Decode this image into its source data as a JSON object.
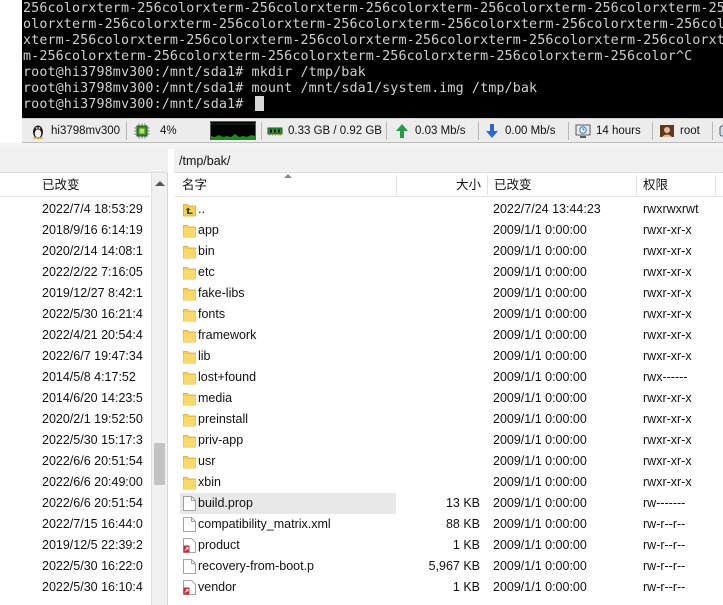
{
  "terminal": {
    "lines": [
      "256colorxterm-256colorxterm-256colorxterm-256colorxterm-256colorxterm-256colorxterm-256color",
      "olorxterm-256colorxterm-256colorxterm-256colorxterm-256colorxterm-256colorxterm-256colorxterm-256col",
      "xterm-256colorxterm-256colorxterm-256colorxterm-256colorxterm-256colorxterm-256colorxterm-256colorx",
      "m-256colorxterm-256colorxterm-256colorxterm-256colorxterm-256colorxterm-256color^C",
      "root@hi3798mv300:/mnt/sda1# mkdir /tmp/bak",
      "root@hi3798mv300:/mnt/sda1# mount /mnt/sda1/system.img /tmp/bak",
      "root@hi3798mv300:/mnt/sda1# "
    ]
  },
  "status_bar": {
    "hostname": "hi3798mv300",
    "cpu": "4%",
    "memory": "0.33 GB / 0.92 GB",
    "upload": "0.03 Mb/s",
    "download": "0.00 Mb/s",
    "uptime": "14 hours",
    "user": "root",
    "icons": [
      "linux-penguin-icon",
      "cpu-chip-icon",
      "cpu-graph",
      "memory-icon",
      "upload-arrow-icon",
      "download-arrow-icon",
      "uptime-monitor-icon",
      "user-icon",
      "disk-icon"
    ]
  },
  "left_pane": {
    "column_modified": "已改变",
    "dates": [
      "2022/7/4  18:53:29",
      "2018/9/16  6:14:19",
      "2020/2/14  14:08:1",
      "2022/2/22  7:16:05",
      "2019/12/27  8:42:1",
      "2022/5/30  16:21:4",
      "2022/4/21  20:54:4",
      "2022/6/7  19:47:34",
      "2014/5/8  4:17:52",
      "2014/6/20  14:23:5",
      "2020/2/1  19:52:50",
      "2022/5/30  15:17:3",
      "2022/6/6  20:51:54",
      "2022/6/6  20:49:00",
      "2022/6/6  20:51:54",
      "2022/7/15  16:44:0",
      "2019/12/5  22:39:2",
      "2022/5/30  16:22:0",
      "2022/5/30  16:10:4"
    ]
  },
  "right_pane": {
    "path": "/tmp/bak/",
    "columns": {
      "name": "名字",
      "size": "大小",
      "modified": "已改变",
      "permissions": "权限"
    },
    "rows": [
      {
        "name": "..",
        "size": "",
        "date": "2022/7/24 13:44:23",
        "perm": "rwxrwxrwt",
        "icon": "parent-folder-icon"
      },
      {
        "name": "app",
        "size": "",
        "date": "2009/1/1 0:00:00",
        "perm": "rwxr-xr-x",
        "icon": "folder-icon"
      },
      {
        "name": "bin",
        "size": "",
        "date": "2009/1/1 0:00:00",
        "perm": "rwxr-xr-x",
        "icon": "folder-icon"
      },
      {
        "name": "etc",
        "size": "",
        "date": "2009/1/1 0:00:00",
        "perm": "rwxr-xr-x",
        "icon": "folder-icon"
      },
      {
        "name": "fake-libs",
        "size": "",
        "date": "2009/1/1 0:00:00",
        "perm": "rwxr-xr-x",
        "icon": "folder-icon"
      },
      {
        "name": "fonts",
        "size": "",
        "date": "2009/1/1 0:00:00",
        "perm": "rwxr-xr-x",
        "icon": "folder-icon"
      },
      {
        "name": "framework",
        "size": "",
        "date": "2009/1/1 0:00:00",
        "perm": "rwxr-xr-x",
        "icon": "folder-icon"
      },
      {
        "name": "lib",
        "size": "",
        "date": "2009/1/1 0:00:00",
        "perm": "rwxr-xr-x",
        "icon": "folder-icon"
      },
      {
        "name": "lost+found",
        "size": "",
        "date": "2009/1/1 0:00:00",
        "perm": "rwx------",
        "icon": "folder-icon"
      },
      {
        "name": "media",
        "size": "",
        "date": "2009/1/1 0:00:00",
        "perm": "rwxr-xr-x",
        "icon": "folder-icon"
      },
      {
        "name": "preinstall",
        "size": "",
        "date": "2009/1/1 0:00:00",
        "perm": "rwxr-xr-x",
        "icon": "folder-icon"
      },
      {
        "name": "priv-app",
        "size": "",
        "date": "2009/1/1 0:00:00",
        "perm": "rwxr-xr-x",
        "icon": "folder-icon"
      },
      {
        "name": "usr",
        "size": "",
        "date": "2009/1/1 0:00:00",
        "perm": "rwxr-xr-x",
        "icon": "folder-icon"
      },
      {
        "name": "xbin",
        "size": "",
        "date": "2009/1/1 0:00:00",
        "perm": "rwxr-xr-x",
        "icon": "folder-icon"
      },
      {
        "name": "build.prop",
        "size": "13 KB",
        "date": "2009/1/1 0:00:00",
        "perm": "rw-------",
        "icon": "file-icon"
      },
      {
        "name": "compatibility_matrix.xml",
        "size": "88 KB",
        "date": "2009/1/1 0:00:00",
        "perm": "rw-r--r--",
        "icon": "file-icon"
      },
      {
        "name": "product",
        "size": "1 KB",
        "date": "2009/1/1 0:00:00",
        "perm": "rw-r--r--",
        "icon": "link-file-icon"
      },
      {
        "name": "recovery-from-boot.p",
        "size": "5,967 KB",
        "date": "2009/1/1 0:00:00",
        "perm": "rw-r--r--",
        "icon": "file-icon"
      },
      {
        "name": "vendor",
        "size": "1 KB",
        "date": "2009/1/1 0:00:00",
        "perm": "rw-r--r--",
        "icon": "link-file-icon"
      }
    ],
    "selected_name": "build.prop"
  }
}
